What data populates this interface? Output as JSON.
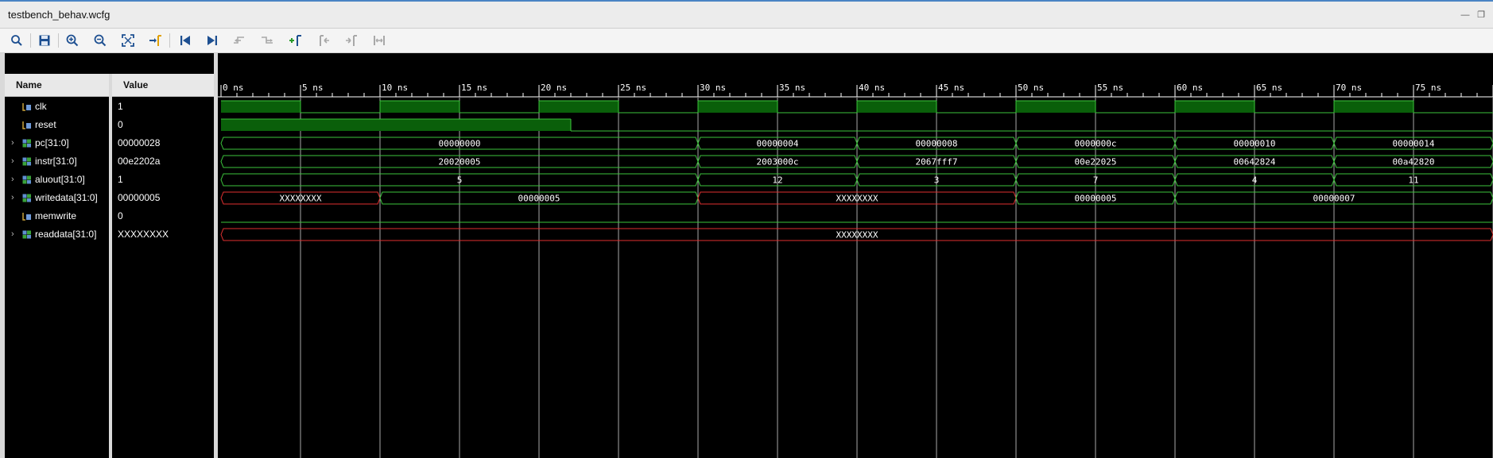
{
  "window": {
    "title": "testbench_behav.wcfg"
  },
  "columns": {
    "name": "Name",
    "value": "Value"
  },
  "colors": {
    "signal": "#3cc43c",
    "fill": "#0a5f0a",
    "unknown": "#e03030",
    "grid": "#a8a8a8",
    "text": "#ffffff"
  },
  "timeline": {
    "unit": "ns",
    "ticks": [
      "0 ns",
      "5 ns",
      "10 ns",
      "15 ns",
      "20 ns",
      "25 ns",
      "30 ns",
      "35 ns",
      "40 ns",
      "45 ns",
      "50 ns",
      "55 ns",
      "60 ns",
      "65 ns",
      "70 ns",
      "75 ns"
    ],
    "visible_end_ns": 80
  },
  "signals": [
    {
      "name": "clk",
      "value": "1",
      "type": "bit",
      "expandable": false,
      "segments": [
        {
          "t0": 0,
          "t1": 5,
          "v": "1"
        },
        {
          "t0": 5,
          "t1": 10,
          "v": "0"
        },
        {
          "t0": 10,
          "t1": 15,
          "v": "1"
        },
        {
          "t0": 15,
          "t1": 20,
          "v": "0"
        },
        {
          "t0": 20,
          "t1": 25,
          "v": "1"
        },
        {
          "t0": 25,
          "t1": 30,
          "v": "0"
        },
        {
          "t0": 30,
          "t1": 35,
          "v": "1"
        },
        {
          "t0": 35,
          "t1": 40,
          "v": "0"
        },
        {
          "t0": 40,
          "t1": 45,
          "v": "1"
        },
        {
          "t0": 45,
          "t1": 50,
          "v": "0"
        },
        {
          "t0": 50,
          "t1": 55,
          "v": "1"
        },
        {
          "t0": 55,
          "t1": 60,
          "v": "0"
        },
        {
          "t0": 60,
          "t1": 65,
          "v": "1"
        },
        {
          "t0": 65,
          "t1": 70,
          "v": "0"
        },
        {
          "t0": 70,
          "t1": 75,
          "v": "1"
        },
        {
          "t0": 75,
          "t1": 80,
          "v": "0"
        }
      ]
    },
    {
      "name": "reset",
      "value": "0",
      "type": "bit",
      "expandable": false,
      "segments": [
        {
          "t0": 0,
          "t1": 22,
          "v": "1"
        },
        {
          "t0": 22,
          "t1": 80,
          "v": "0"
        }
      ]
    },
    {
      "name": "pc[31:0]",
      "value": "00000028",
      "type": "bus",
      "expandable": true,
      "segments": [
        {
          "t0": 0,
          "t1": 30,
          "v": "00000000"
        },
        {
          "t0": 30,
          "t1": 40,
          "v": "00000004"
        },
        {
          "t0": 40,
          "t1": 50,
          "v": "00000008"
        },
        {
          "t0": 50,
          "t1": 60,
          "v": "0000000c"
        },
        {
          "t0": 60,
          "t1": 70,
          "v": "00000010"
        },
        {
          "t0": 70,
          "t1": 80,
          "v": "00000014"
        }
      ]
    },
    {
      "name": "instr[31:0]",
      "value": "00e2202a",
      "type": "bus",
      "expandable": true,
      "segments": [
        {
          "t0": 0,
          "t1": 30,
          "v": "20020005"
        },
        {
          "t0": 30,
          "t1": 40,
          "v": "2003000c"
        },
        {
          "t0": 40,
          "t1": 50,
          "v": "2067fff7"
        },
        {
          "t0": 50,
          "t1": 60,
          "v": "00e22025"
        },
        {
          "t0": 60,
          "t1": 70,
          "v": "00642824"
        },
        {
          "t0": 70,
          "t1": 80,
          "v": "00a42820"
        }
      ]
    },
    {
      "name": "aluout[31:0]",
      "value": "1",
      "type": "bus",
      "expandable": true,
      "segments": [
        {
          "t0": 0,
          "t1": 30,
          "v": "5"
        },
        {
          "t0": 30,
          "t1": 40,
          "v": "12"
        },
        {
          "t0": 40,
          "t1": 50,
          "v": "3"
        },
        {
          "t0": 50,
          "t1": 60,
          "v": "7"
        },
        {
          "t0": 60,
          "t1": 70,
          "v": "4"
        },
        {
          "t0": 70,
          "t1": 80,
          "v": "11"
        }
      ]
    },
    {
      "name": "writedata[31:0]",
      "value": "00000005",
      "type": "bus",
      "expandable": true,
      "segments": [
        {
          "t0": 0,
          "t1": 10,
          "v": "XXXXXXXX",
          "x": true
        },
        {
          "t0": 10,
          "t1": 30,
          "v": "00000005"
        },
        {
          "t0": 30,
          "t1": 50,
          "v": "XXXXXXXX",
          "x": true
        },
        {
          "t0": 50,
          "t1": 60,
          "v": "00000005"
        },
        {
          "t0": 60,
          "t1": 80,
          "v": "00000007"
        }
      ]
    },
    {
      "name": "memwrite",
      "value": "0",
      "type": "bit",
      "expandable": false,
      "segments": [
        {
          "t0": 0,
          "t1": 80,
          "v": "0"
        }
      ]
    },
    {
      "name": "readdata[31:0]",
      "value": "XXXXXXXX",
      "type": "bus",
      "expandable": true,
      "segments": [
        {
          "t0": 0,
          "t1": 80,
          "v": "XXXXXXXX",
          "x": true
        }
      ]
    }
  ],
  "icons": [
    "search-icon",
    "save-icon",
    "zoom-in-icon",
    "zoom-out-icon",
    "zoom-fit-icon",
    "go-to-cursor-icon",
    "go-to-start-icon",
    "go-to-end-icon",
    "previous-transition-icon",
    "next-transition-icon",
    "add-marker-icon",
    "previous-marker-icon",
    "next-marker-icon",
    "swap-cursors-icon"
  ]
}
